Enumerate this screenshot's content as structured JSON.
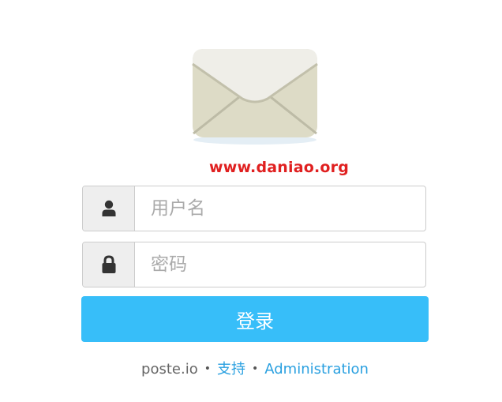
{
  "watermark": "www.daniao.org",
  "form": {
    "username": {
      "icon": "user-icon",
      "placeholder": "用户名",
      "value": ""
    },
    "password": {
      "icon": "lock-icon",
      "placeholder": "密码",
      "value": ""
    },
    "submit_label": "登录"
  },
  "footer": {
    "brand": "poste.io",
    "separator": "•",
    "support_label": "支持",
    "admin_label": "Administration"
  },
  "colors": {
    "button": "#37bef9",
    "link": "#2aa0e0",
    "watermark": "#e02020",
    "addon_bg": "#eeeeee"
  }
}
